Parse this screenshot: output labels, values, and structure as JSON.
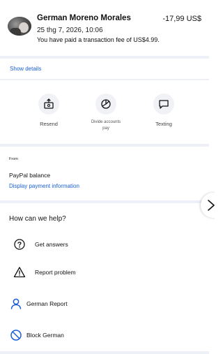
{
  "transaction": {
    "name": "German Moreno Morales",
    "amount": "-17,99 US$",
    "date": "25 thg 7, 2026, 10:06",
    "fee_note": "You have paid a transaction fee of US$4.99."
  },
  "show_details": "Show details",
  "actions": [
    {
      "label": "Resend",
      "icon": "money-resend-icon"
    },
    {
      "label": "Divide accounts pay",
      "icon": "split-pie-icon"
    },
    {
      "label": "Texting",
      "icon": "message-icon"
    }
  ],
  "from": {
    "label": "From",
    "value": "PayPal balance",
    "link": "Display payment information"
  },
  "help": {
    "title": "How can we help?",
    "items": [
      {
        "label": "Get answers",
        "icon": "question-circle-icon"
      },
      {
        "label": "Report problem",
        "icon": "warning-triangle-icon"
      },
      {
        "label": "German Report",
        "icon": "person-icon"
      },
      {
        "label": "Block German",
        "icon": "block-icon"
      }
    ]
  },
  "colors": {
    "link": "#1a5fd6",
    "separator": "#eef0f8",
    "icon_background": "#f1f2f6"
  }
}
